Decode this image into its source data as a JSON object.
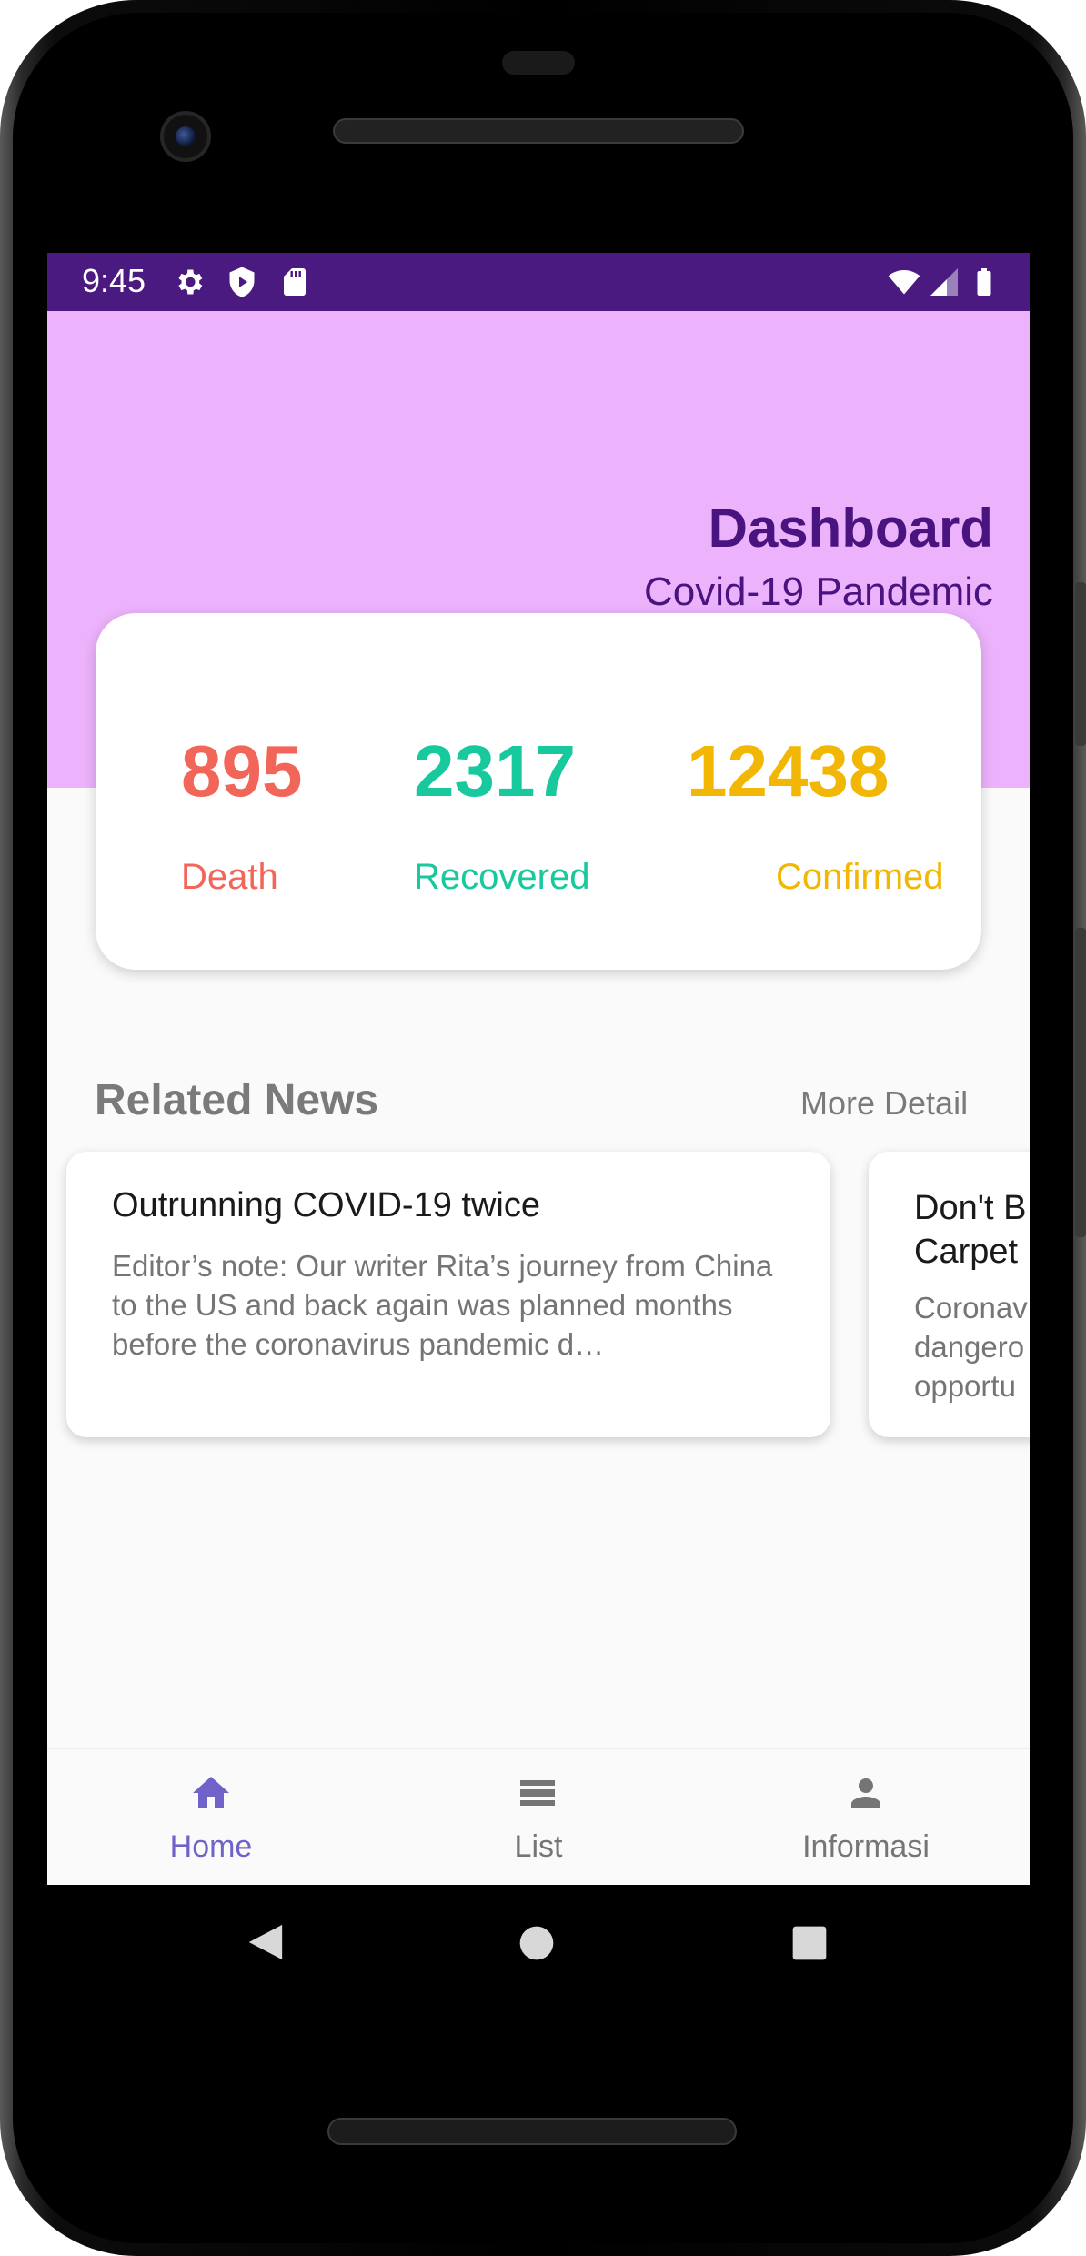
{
  "status_bar": {
    "time": "9:45",
    "left_icons": [
      "gear-icon",
      "shield-icon",
      "sd-card-icon"
    ],
    "right_icons": [
      "wifi-icon",
      "signal-icon",
      "battery-icon"
    ]
  },
  "header": {
    "title": "Dashboard",
    "subtitle": "Covid-19 Pandemic"
  },
  "stats": [
    {
      "value": "895",
      "label": "Death",
      "color": "#f2665a"
    },
    {
      "value": "2317",
      "label": "Recovered",
      "color": "#17c99d"
    },
    {
      "value": "12438",
      "label": "Confirmed",
      "color": "#f2b705"
    }
  ],
  "news_section": {
    "title": "Related News",
    "more_label": "More Detail",
    "cards": [
      {
        "title": "Outrunning COVID-19 twice",
        "body": "Editor’s note: Our writer Rita’s journey from China to the US and back again was planned months before the coronavirus pandemic d…"
      },
      {
        "title_line1": "Don't B",
        "title_line2": "Carpet",
        "body_line1": "Coronav",
        "body_line2": "dangero",
        "body_line3": "opportu"
      }
    ]
  },
  "bottom_nav": {
    "active_color": "#6f63c9",
    "inactive_color": "#757575",
    "items": [
      {
        "label": "Home",
        "icon": "home-icon",
        "active": true
      },
      {
        "label": "List",
        "icon": "list-icon",
        "active": false
      },
      {
        "label": "Informasi",
        "icon": "person-icon",
        "active": false
      }
    ]
  },
  "colors": {
    "status_bar": "#4a1a80",
    "header_bg": "#ecb2fb",
    "title": "#4a1480"
  }
}
